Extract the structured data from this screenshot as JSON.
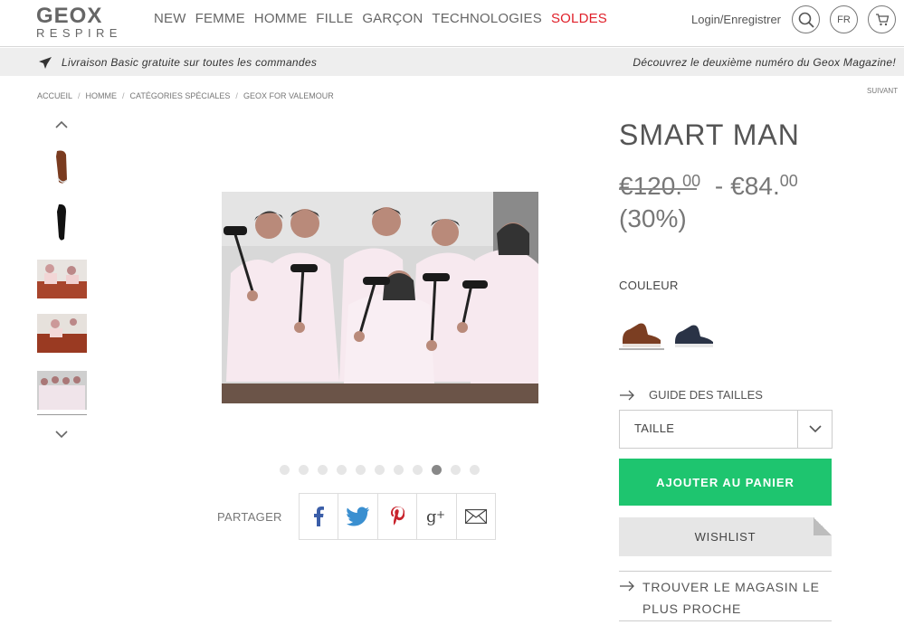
{
  "header": {
    "logo_top": "GEOX",
    "logo_bottom": "RESPIRE",
    "nav": [
      {
        "label": "NEW"
      },
      {
        "label": "FEMME"
      },
      {
        "label": "HOMME"
      },
      {
        "label": "FILLE"
      },
      {
        "label": "GARÇON"
      },
      {
        "label": "TECHNOLOGIES"
      },
      {
        "label": "SOLDES"
      }
    ],
    "login_label": "Login/Enregistrer",
    "lang_label": "FR",
    "search_icon": "search-icon",
    "cart_icon": "cart-icon"
  },
  "promo": {
    "left_text": "Livraison Basic gratuite sur toutes les commandes",
    "right_text": "Découvrez le deuxième numéro du Geox Magazine!"
  },
  "breadcrumb": {
    "items": [
      "ACCUEIL",
      "HOMME",
      "CATÉGORIES SPÉCIALES",
      "GEOX FOR VALEMOUR"
    ],
    "separator": "/",
    "next_label": "SUIVANT"
  },
  "gallery": {
    "dot_count": 11,
    "active_dot": 8
  },
  "share": {
    "label": "PARTAGER",
    "icons": [
      "facebook-icon",
      "twitter-icon",
      "pinterest-icon",
      "google-plus-icon",
      "email-icon"
    ]
  },
  "product": {
    "title": "SMART MAN",
    "old_price_currency": "€",
    "old_price_main": "120",
    "old_price_decimals": "00",
    "dash": "-",
    "new_price_currency": "€",
    "new_price_main": "84",
    "new_price_decimals": "00",
    "discount": "(30%)",
    "colour_label": "COULEUR",
    "size_guide_label": "GUIDE DES TAILLES",
    "size_select_label": "TAILLE",
    "add_to_cart_label": "AJOUTER AU PANIER",
    "wishlist_label": "WISHLIST",
    "store_line1": "TROUVER LE MAGASIN LE",
    "store_line2": "PLUS PROCHE"
  },
  "colors": {
    "sale": "#e0202a",
    "add_to_cart": "#1ec56f",
    "promo_bg": "#eeeeee"
  }
}
